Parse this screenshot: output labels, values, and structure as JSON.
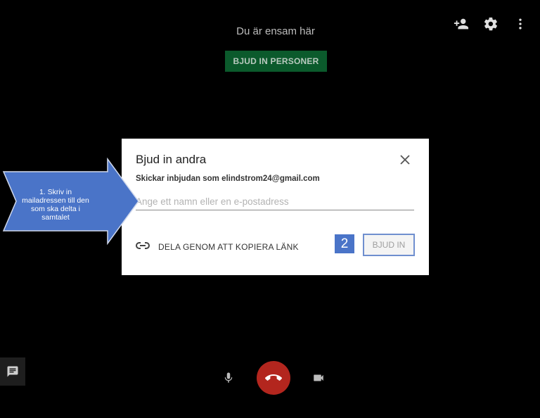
{
  "top": {
    "status": "Du är ensam här",
    "invite_people_label": "BJUD IN PERSONER",
    "icons": [
      "add-person-icon",
      "gear-icon",
      "more-vert-icon"
    ]
  },
  "dialog": {
    "title": "Bjud in andra",
    "sender": "Skickar inbjudan som elindstrom24@gmail.com",
    "input_placeholder": "Ange ett namn eller en e-postadress",
    "input_value": "",
    "share_label": "DELA GENOM ATT KOPIERA LÄNK",
    "step_badge": "2",
    "invite_label": "BJUD IN"
  },
  "callout": {
    "text": "1. Skriv in mailadressen till den som ska delta i samtalet",
    "color": "#4a74c8"
  },
  "controls": {
    "hangup_color": "#b3261e"
  }
}
